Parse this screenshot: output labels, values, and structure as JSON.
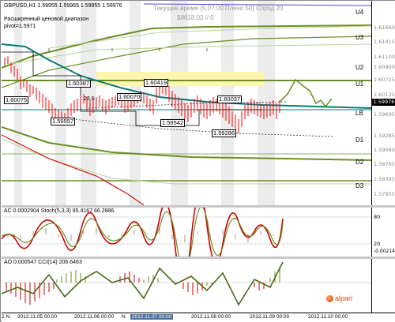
{
  "header": {
    "symbol_line": "GBPUSD,H1  1.59955 1.59965 1.59955 1.59976",
    "indicator_name": "Расширенный ценовой диапазон",
    "pivot_label": "pivot=1.5971",
    "overlay_line1": "Текущее время (5:07.00 Плечо 50) Спрэд 20",
    "overlay_line2": "$9618.03",
    "overlay_line2b": "// 0"
  },
  "levels": [
    "U4",
    "U3",
    "U2",
    "U1",
    "LB",
    "D1",
    "D2",
    "D3"
  ],
  "price_labels": [
    "1.60075",
    "1.60387",
    "1.60419",
    "1.60070",
    "1.59557",
    "1.59542",
    "1.60037",
    "1.59286"
  ],
  "annotation": "23.6",
  "price_scale": {
    "ticks": [
      "1.61660",
      "1.61415",
      "1.61100",
      "1.60900",
      "1.60715",
      "1.60135",
      "1.59976",
      "1.59695",
      "1.59285",
      "1.59080",
      "1.58765",
      "1.58395",
      "1.57955"
    ],
    "current": "1.59976"
  },
  "ac_stoch": {
    "header": "AC 0.0002904  Stoch(5,3,3) 85.4167 66.2886",
    "scale": [
      "80",
      "20",
      "-0.00214"
    ]
  },
  "ao_cci": {
    "header": "AO 0.000547  CCI(14) 206.6463"
  },
  "time_axis": {
    "labels": [
      "2 N",
      "2012.11.05 00:00",
      "2012.11.06 00:00",
      "N",
      "2012.11.07 00:00",
      "2012.11.08 00:00",
      "2012.11.09 00:00",
      "2012.11.10 00:00"
    ],
    "selected": "2012.11.07 00:00"
  },
  "brand": "alpari",
  "colors": {
    "candle": "#ff0000",
    "line_teal": "#0a7a7a",
    "band_olive": "#6b8e23",
    "band_red": "#cc1111",
    "stoch_fast": "#cc0000",
    "stoch_slow": "#6b8e23",
    "zone_fill": "#fff7b0"
  }
}
